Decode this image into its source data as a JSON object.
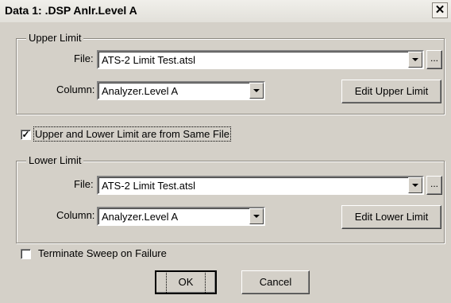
{
  "window": {
    "title": "Data 1: .DSP Anlr.Level A",
    "close_glyph": "✕"
  },
  "upper": {
    "group_label": "Upper Limit",
    "file_label": "File:",
    "file_value": "ATS-2 Limit Test.atsl",
    "browse_label": "...",
    "column_label": "Column:",
    "column_value": "Analyzer.Level A",
    "edit_label": "Edit Upper Limit"
  },
  "same_file": {
    "checked_glyph": "✓",
    "label": "Upper and Lower Limit are from Same File"
  },
  "lower": {
    "group_label": "Lower Limit",
    "file_label": "File:",
    "file_value": "ATS-2 Limit Test.atsl",
    "browse_label": "...",
    "column_label": "Column:",
    "column_value": "Analyzer.Level A",
    "edit_label": "Edit Lower Limit"
  },
  "terminate": {
    "label": "Terminate Sweep on Failure"
  },
  "buttons": {
    "ok": "OK",
    "cancel": "Cancel"
  }
}
